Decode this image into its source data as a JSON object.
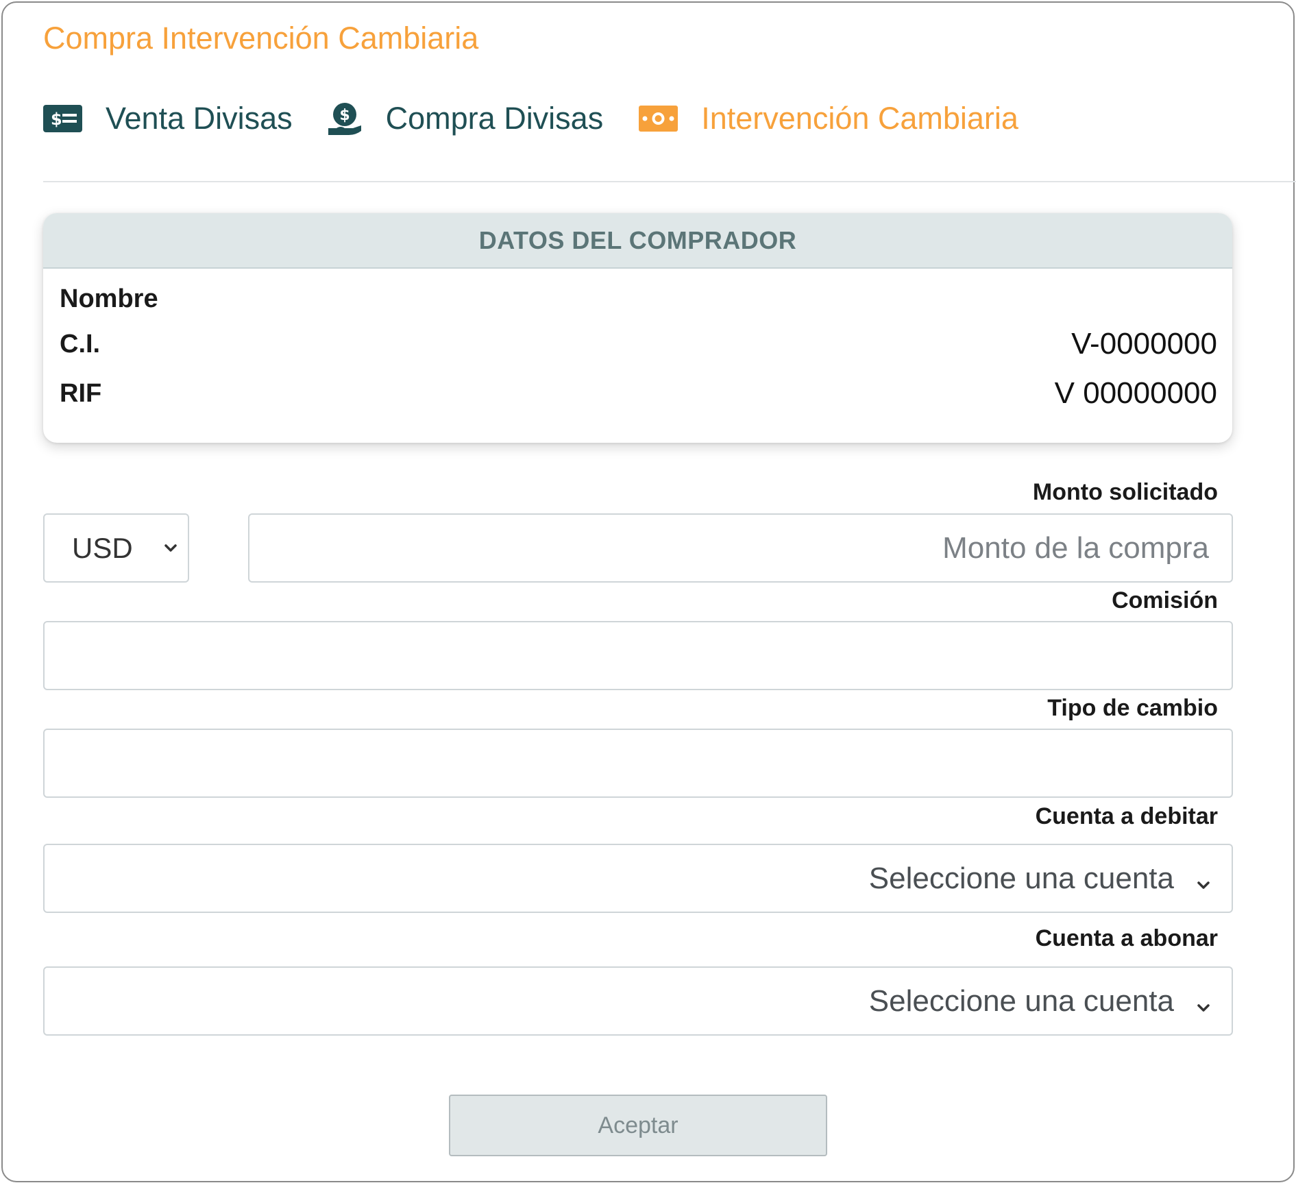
{
  "page": {
    "title": "Compra Intervención Cambiaria"
  },
  "tabs": [
    {
      "label": "Venta Divisas",
      "icon": "money-card-icon",
      "active": false
    },
    {
      "label": "Compra Divisas",
      "icon": "money-hand-icon",
      "active": false
    },
    {
      "label": "Intervención Cambiaria",
      "icon": "banknote-icon",
      "active": true
    }
  ],
  "buyer_card": {
    "header": "DATOS DEL COMPRADOR",
    "rows": [
      {
        "label": "Nombre",
        "value": ""
      },
      {
        "label": "C.I.",
        "value": "V-0000000"
      },
      {
        "label": "RIF",
        "value": "V 00000000"
      }
    ]
  },
  "form": {
    "amount": {
      "label": "Monto solicitado",
      "currency": "USD",
      "placeholder": "Monto de la compra",
      "value": ""
    },
    "commission": {
      "label": "Comisión",
      "value": ""
    },
    "exchange_rate": {
      "label": "Tipo de cambio",
      "value": ""
    },
    "debit_account": {
      "label": "Cuenta a debitar",
      "selected": "Seleccione una cuenta"
    },
    "credit_account": {
      "label": "Cuenta a abonar",
      "selected": "Seleccione una cuenta"
    },
    "submit_label": "Aceptar"
  },
  "colors": {
    "accent": "#f7a13b",
    "dark_teal": "#1f4f54",
    "header_bg": "#dfe7e8",
    "button_bg": "#e1e7e8"
  }
}
